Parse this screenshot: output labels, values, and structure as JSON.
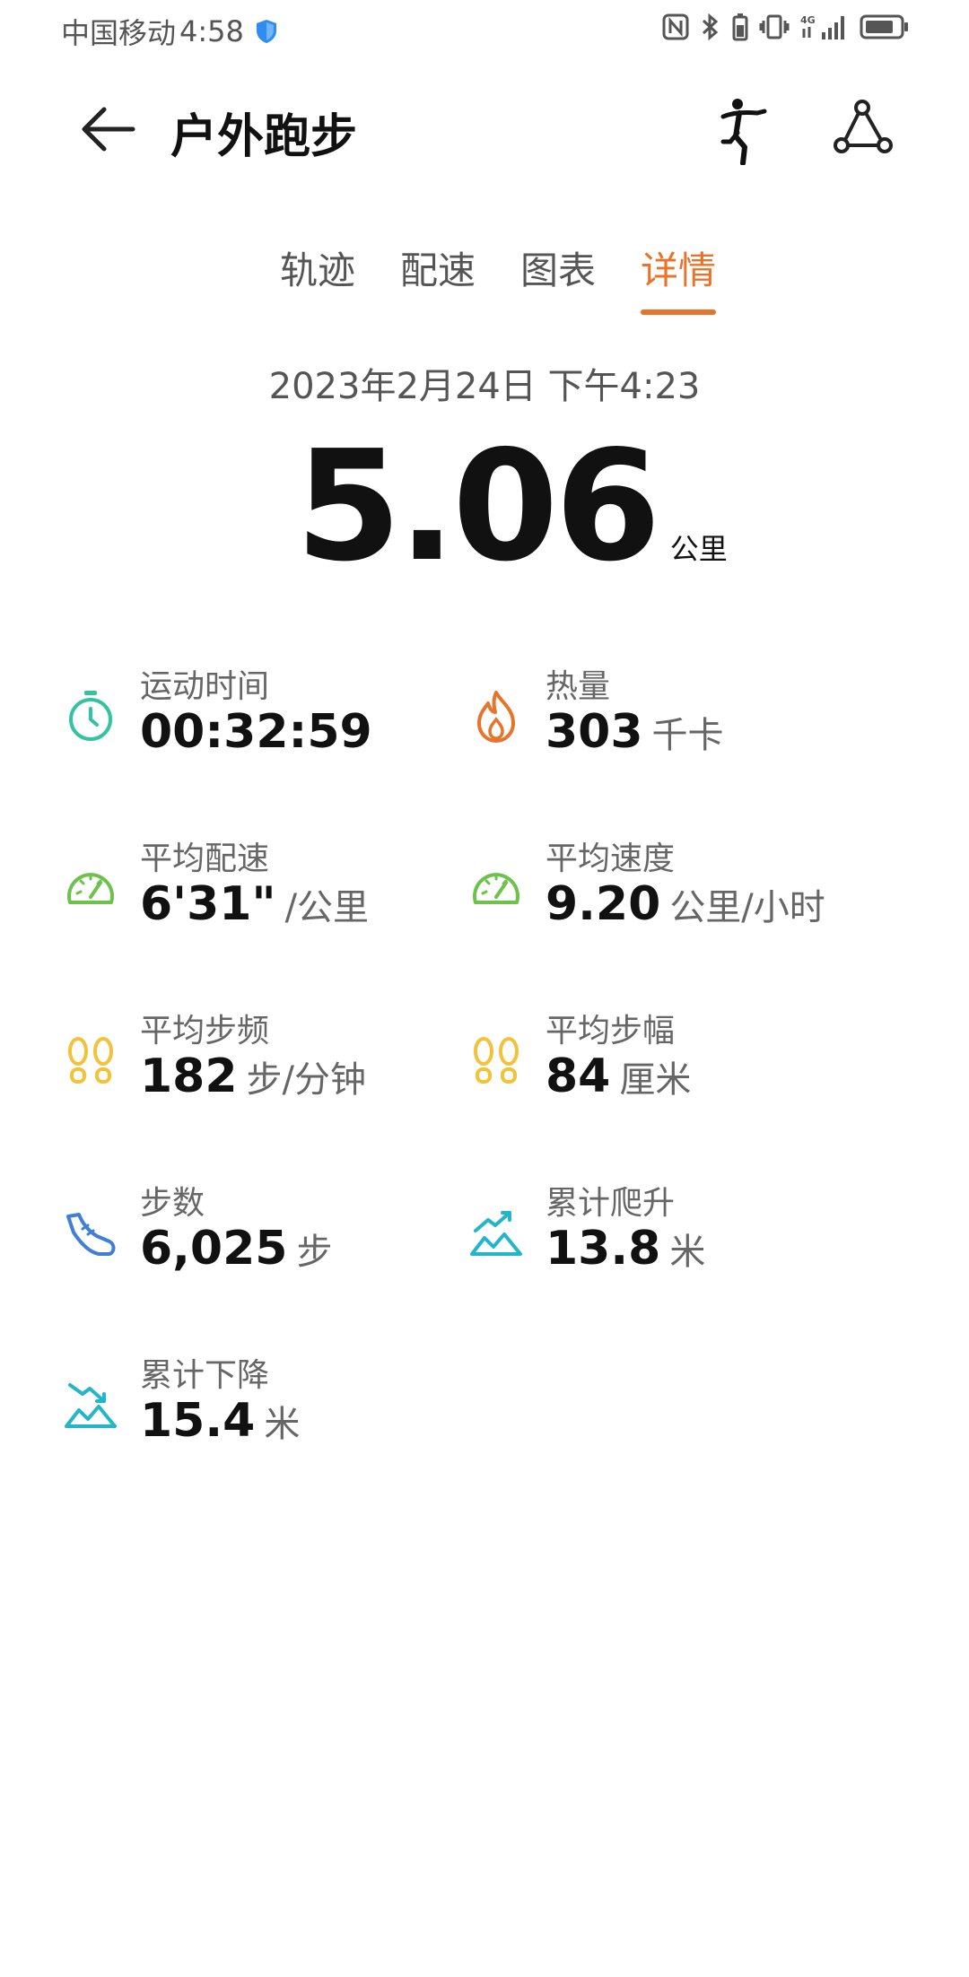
{
  "status_bar": {
    "carrier": "中国移动",
    "time": "4:58"
  },
  "header": {
    "title": "户外跑步"
  },
  "tabs": [
    {
      "label": "轨迹",
      "active": false
    },
    {
      "label": "配速",
      "active": false
    },
    {
      "label": "图表",
      "active": false
    },
    {
      "label": "详情",
      "active": true
    }
  ],
  "summary": {
    "date": "2023年2月24日 下午4:23",
    "distance": "5.06",
    "distance_unit": "公里"
  },
  "metrics": [
    {
      "label": "运动时间",
      "value": "00:32:59",
      "unit": "",
      "icon": "stopwatch-icon",
      "color": "#34c3a0"
    },
    {
      "label": "热量",
      "value": "303",
      "unit": "千卡",
      "icon": "flame-icon",
      "color": "#e8742c"
    },
    {
      "label": "平均配速",
      "value": "6'31\"",
      "unit": "/公里",
      "icon": "speedometer-icon",
      "color": "#6cc24a"
    },
    {
      "label": "平均速度",
      "value": "9.20",
      "unit": "公里/小时",
      "icon": "speedometer-icon",
      "color": "#6cc24a"
    },
    {
      "label": "平均步频",
      "value": "182",
      "unit": "步/分钟",
      "icon": "footprints-icon",
      "color": "#f2c23a"
    },
    {
      "label": "平均步幅",
      "value": "84",
      "unit": "厘米",
      "icon": "footprints-icon",
      "color": "#f2c23a"
    },
    {
      "label": "步数",
      "value": "6,025",
      "unit": "步",
      "icon": "shoe-icon",
      "color": "#3f7fd6"
    },
    {
      "label": "累计爬升",
      "value": "13.8",
      "unit": "米",
      "icon": "climb-icon",
      "color": "#22b6c8"
    },
    {
      "label": "累计下降",
      "value": "15.4",
      "unit": "米",
      "icon": "descent-icon",
      "color": "#22b6c8"
    }
  ],
  "colors": {
    "accent": "#e8742c",
    "text_primary": "#111111",
    "text_secondary": "#666666"
  }
}
